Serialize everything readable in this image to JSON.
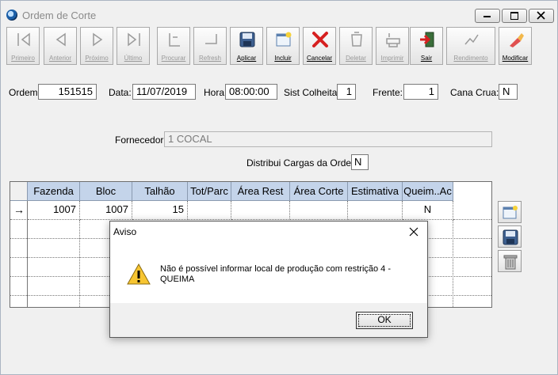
{
  "window": {
    "title": "Ordem de Corte"
  },
  "toolbar": {
    "buttons": [
      {
        "label": "Primeiro",
        "enabled": false,
        "icon": "first-record-icon"
      },
      {
        "label": "Anterior",
        "enabled": false,
        "icon": "previous-record-icon"
      },
      {
        "label": "Próximo",
        "enabled": false,
        "icon": "next-record-icon"
      },
      {
        "label": "Último",
        "enabled": false,
        "icon": "last-record-icon"
      },
      {
        "label": "Procurar",
        "enabled": false,
        "icon": "search-icon"
      },
      {
        "label": "Refresh",
        "enabled": false,
        "icon": "refresh-icon"
      },
      {
        "label": "Aplicar",
        "enabled": true,
        "icon": "save-icon"
      },
      {
        "label": "Incluir",
        "enabled": true,
        "icon": "new-record-icon"
      },
      {
        "label": "Cancelar",
        "enabled": true,
        "icon": "cancel-icon"
      },
      {
        "label": "Deletar",
        "enabled": false,
        "icon": "delete-icon"
      },
      {
        "label": "Imprimir",
        "enabled": false,
        "icon": "print-icon"
      },
      {
        "label": "Sair",
        "enabled": true,
        "icon": "exit-icon"
      },
      {
        "label": "Rendimento",
        "enabled": false,
        "icon": "yield-icon"
      },
      {
        "label": "Modificar",
        "enabled": true,
        "icon": "edit-icon"
      }
    ]
  },
  "form": {
    "ordem_label": "Ordem",
    "ordem_value": "151515",
    "data_label": "Data:",
    "data_value": "11/07/2019",
    "hora_label": "Hora",
    "hora_value": "08:00:00",
    "sist_label": "Sist Colheita:",
    "sist_value": "1",
    "frente_label": "Frente:",
    "frente_value": "1",
    "cana_label": "Cana Crua:",
    "cana_value": "N",
    "fornecedor_label": "Fornecedor:",
    "fornecedor_value": "1 COCAL",
    "distribui_label": "Distribui Cargas da Ordem:",
    "distribui_value": "N"
  },
  "grid": {
    "columns": [
      "Fazenda",
      "Bloc",
      "Talhão",
      "Tot/Parc",
      "Área Rest",
      "Área Corte",
      "Estimativa",
      "Queim..Ac"
    ],
    "rows": [
      {
        "indicator": "→",
        "cells": [
          "1007",
          "1007",
          "15",
          "",
          "",
          "",
          "",
          "N"
        ]
      }
    ]
  },
  "dialog": {
    "title": "Aviso",
    "message_line1": "Não é possível informar local de produção com restrição 4 -",
    "message_line2": "QUEIMA",
    "ok_label": "OK"
  }
}
